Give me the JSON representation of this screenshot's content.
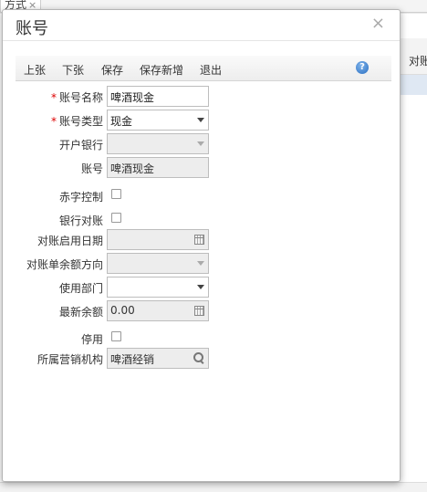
{
  "background": {
    "tab_label": "方式",
    "tab_close": "×",
    "grid_header": "对账"
  },
  "dialog": {
    "title": "账号",
    "close": "×"
  },
  "toolbar": {
    "prev_label": "上张",
    "next_label": "下张",
    "save_label": "保存",
    "save_new_label": "保存新增",
    "exit_label": "退出",
    "help": "?"
  },
  "form": {
    "required_mark": "*",
    "account_name": {
      "label": "账号名称",
      "value": "啤酒现金"
    },
    "account_type": {
      "label": "账号类型",
      "value": "现金"
    },
    "bank": {
      "label": "开户银行",
      "value": ""
    },
    "account_no": {
      "label": "账号",
      "value": "啤酒现金"
    },
    "red_control": {
      "label": "赤字控制",
      "checked": false
    },
    "bank_reconcile": {
      "label": "银行对账",
      "checked": false
    },
    "reconcile_start_date": {
      "label": "对账启用日期",
      "value": ""
    },
    "statement_balance_direction": {
      "label": "对账单余额方向",
      "value": ""
    },
    "department": {
      "label": "使用部门",
      "value": ""
    },
    "latest_balance": {
      "label": "最新余额",
      "value": "0.00"
    },
    "disabled": {
      "label": "停用",
      "checked": false
    },
    "sales_org": {
      "label": "所属营销机构",
      "value": "啤酒经销"
    }
  }
}
